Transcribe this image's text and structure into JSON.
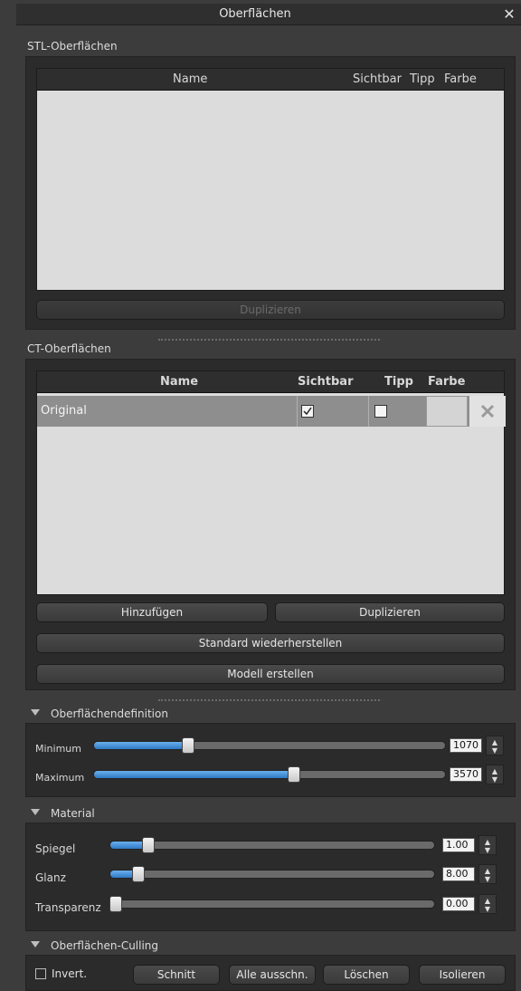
{
  "window": {
    "title": "Oberflächen",
    "close": "✕"
  },
  "stl": {
    "section_label": "STL-Oberflächen",
    "columns": [
      "Name",
      "Sichtbar",
      "Tipp",
      "Farbe"
    ],
    "duplicate_label": "Duplizieren"
  },
  "ct": {
    "section_label": "CT-Oberflächen",
    "columns": [
      "Name",
      "Sichtbar",
      "Tipp",
      "Farbe"
    ],
    "rows": [
      {
        "name": "Original",
        "visible": true,
        "tip": false,
        "color": "#d4d4d4"
      }
    ],
    "add_label": "Hinzufügen",
    "duplicate_label": "Duplizieren",
    "restore_label": "Standard wiederherstellen",
    "create_model_label": "Modell erstellen"
  },
  "surface_definition": {
    "label": "Oberflächendefinition",
    "minimum": {
      "label": "Minimum",
      "value": "1070",
      "fraction": 0.27
    },
    "maximum": {
      "label": "Maximum",
      "value": "3570",
      "fraction": 0.57
    }
  },
  "material": {
    "label": "Material",
    "spiegel": {
      "label": "Spiegel",
      "value": "1.00",
      "fraction": 0.12
    },
    "glanz": {
      "label": "Glanz",
      "value": "8.00",
      "fraction": 0.09
    },
    "transparenz": {
      "label": "Transparenz",
      "value": "0.00",
      "fraction": 0.0
    }
  },
  "culling": {
    "label": "Oberflächen-Culling",
    "invert_label": "Invert.",
    "buttons": [
      "Schnitt",
      "Alle ausschn.",
      "Löschen",
      "Isolieren"
    ]
  },
  "colors": {
    "accent": "#3a8ad6",
    "panel": "#2b2b2b",
    "background": "#3c3c3c"
  },
  "icons": {
    "close": "close-icon",
    "remove": "remove-x-icon",
    "collapse": "triangle-down-icon",
    "spin": "spinner-arrows-icon"
  }
}
